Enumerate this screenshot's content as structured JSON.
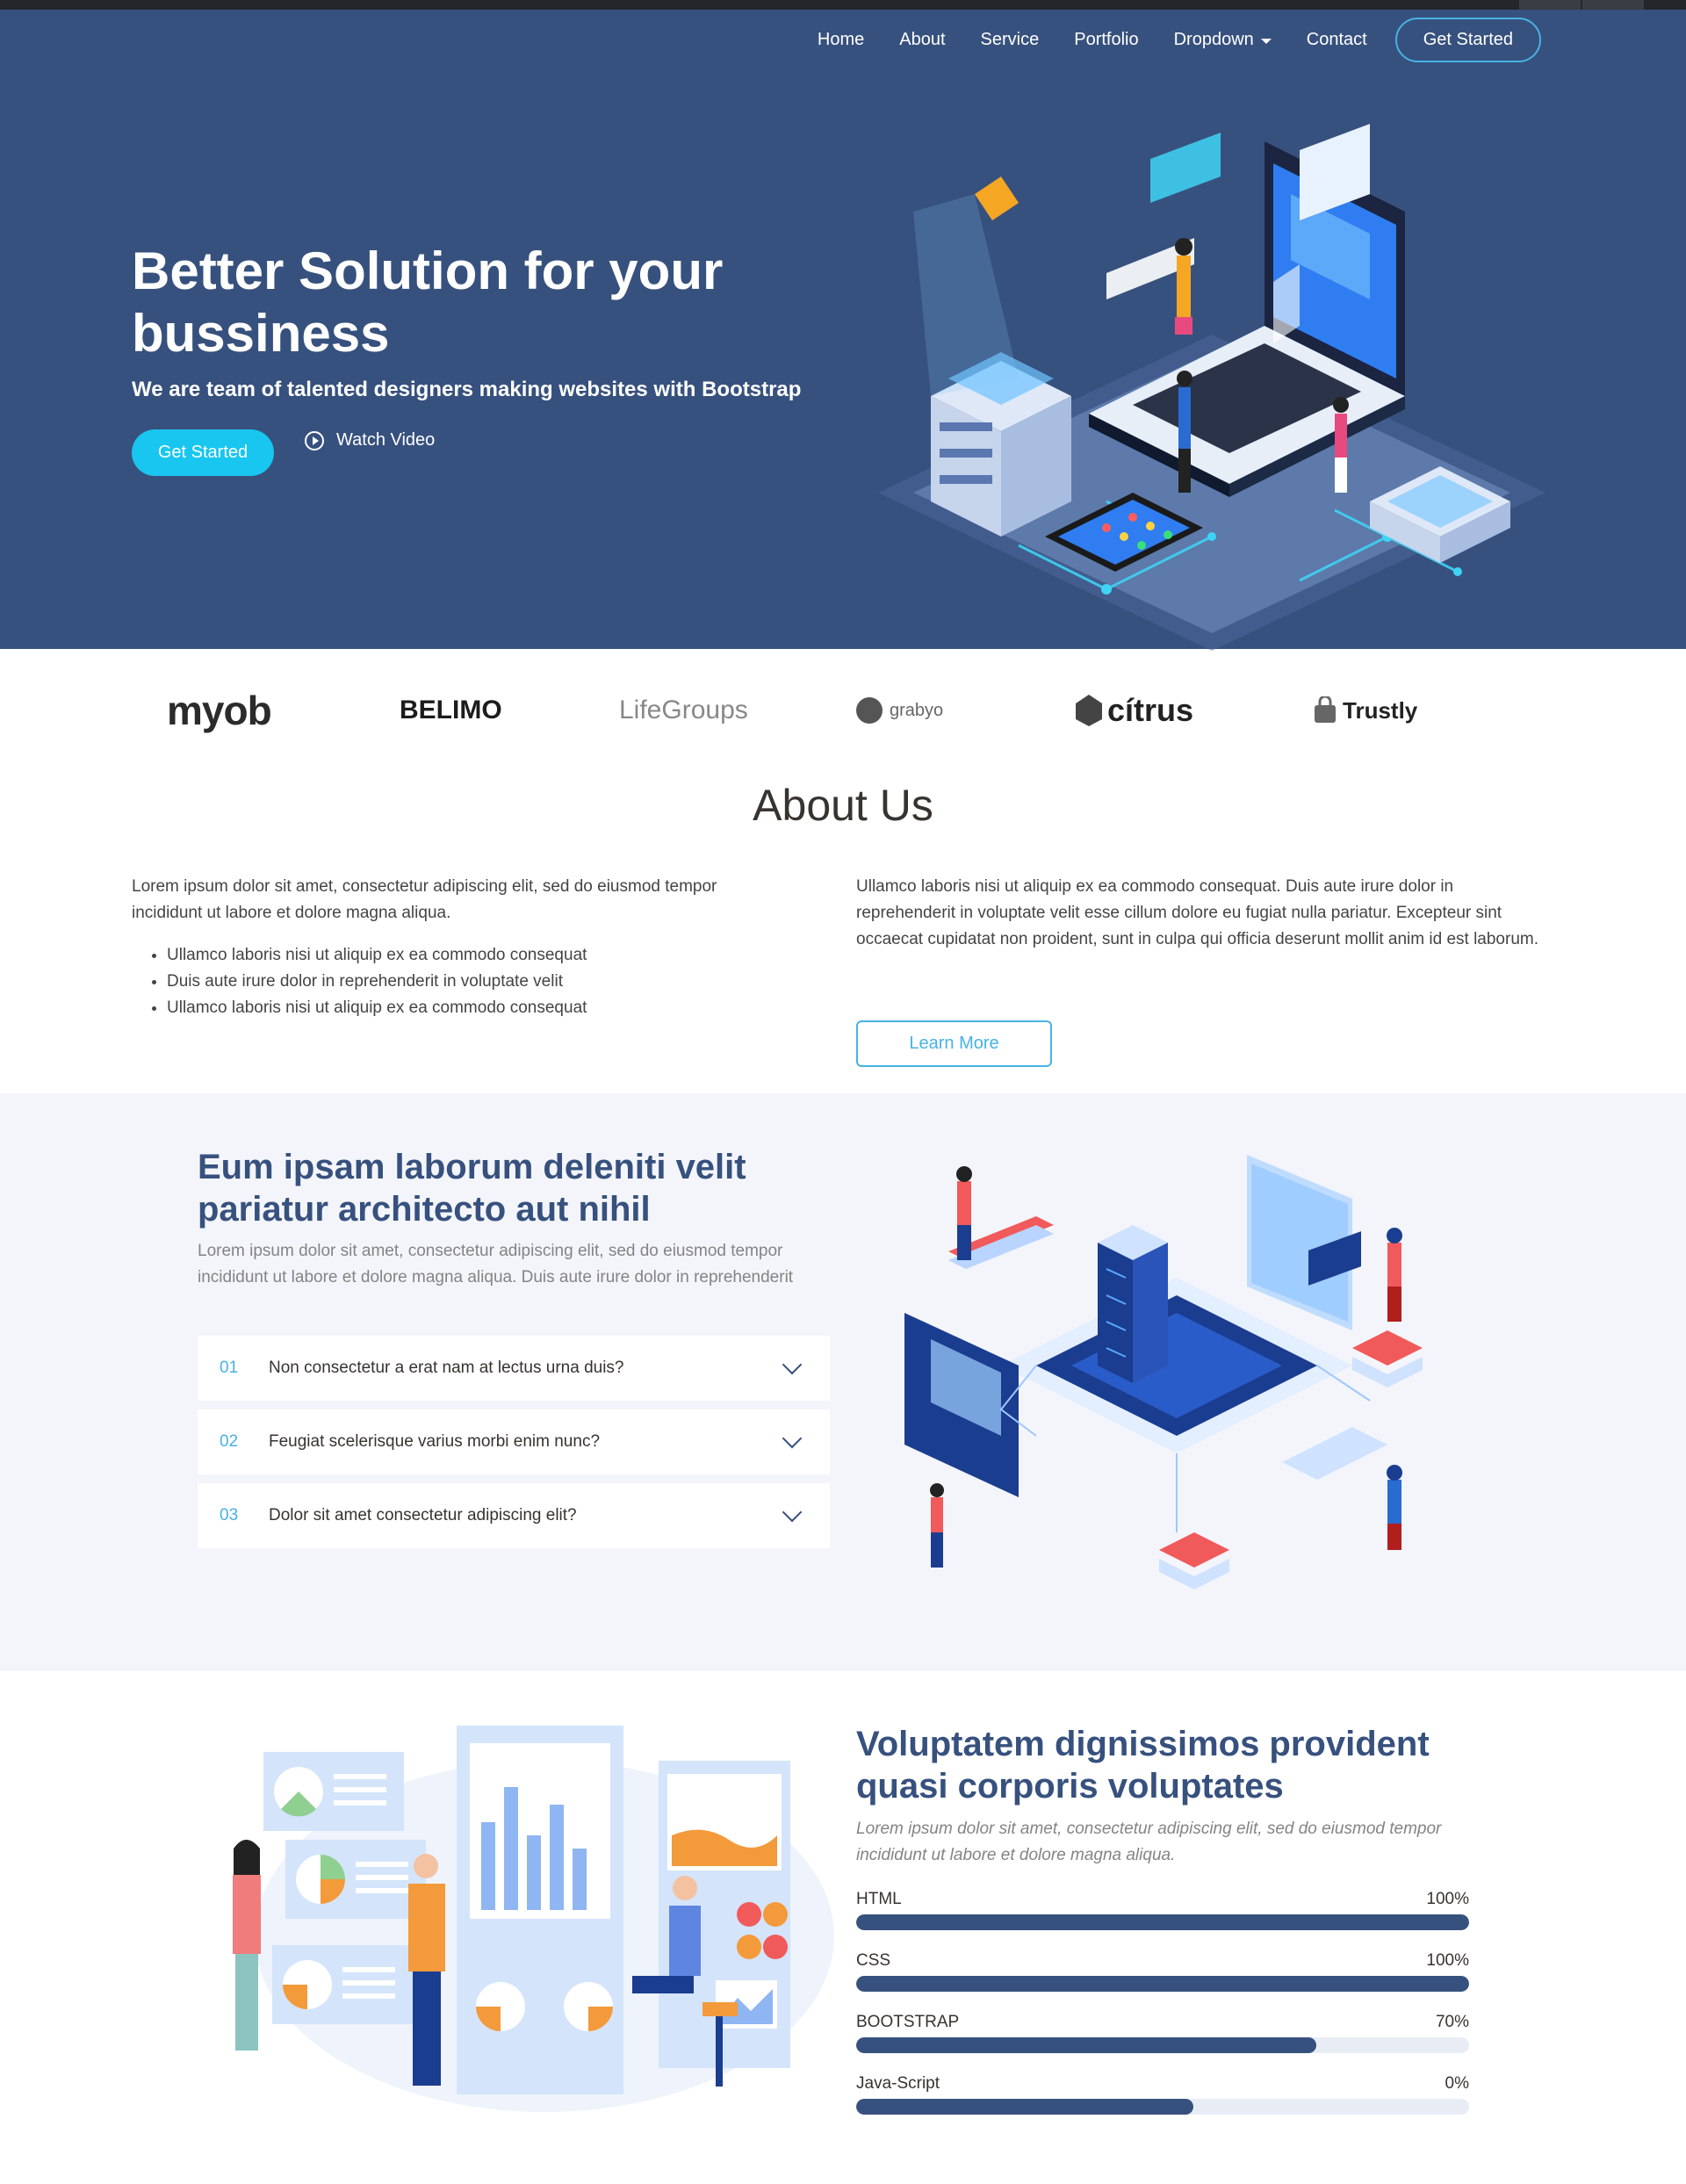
{
  "nav": {
    "items": [
      "Home",
      "About",
      "Service",
      "Portfolio",
      "Dropdown",
      "Contact"
    ],
    "cta": "Get Started"
  },
  "hero": {
    "title": "Better Solution for your bussiness",
    "subtitle": "We are team of talented designers making websites with Bootstrap",
    "button": "Get Started",
    "watch": "Watch Video"
  },
  "clients": [
    "myob",
    "BELIMO",
    "LifeGroups",
    "grabyo",
    "cítrus",
    "Trustly"
  ],
  "about": {
    "title": "About Us",
    "left_text": "Lorem ipsum dolor sit amet, consectetur adipiscing elit, sed do eiusmod tempor incididunt ut labore et dolore magna aliqua.",
    "bullets": [
      "Ullamco laboris nisi ut aliquip ex ea commodo consequat",
      "Duis aute irure dolor in reprehenderit in voluptate velit",
      "Ullamco laboris nisi ut aliquip ex ea commodo consequat"
    ],
    "right_text": "Ullamco laboris nisi ut aliquip ex ea commodo consequat. Duis aute irure dolor in reprehenderit in voluptate velit esse cillum dolore eu fugiat nulla pariatur. Excepteur sint occaecat cupidatat non proident, sunt in culpa qui officia deserunt mollit anim id est laborum.",
    "button": "Learn More"
  },
  "why": {
    "title_normal": "Eum ipsam laborum deleniti ",
    "title_bold_1": "velit",
    "title_bold_2": "pariatur architecto aut nihil",
    "description": "Lorem ipsum dolor sit amet, consectetur adipiscing elit, sed do eiusmod tempor incididunt ut labore et dolore magna aliqua. Duis aute irure dolor in reprehenderit",
    "faqs": [
      {
        "num": "01",
        "question": "Non consectetur a erat nam at lectus urna duis?"
      },
      {
        "num": "02",
        "question": "Feugiat scelerisque varius morbi enim nunc?"
      },
      {
        "num": "03",
        "question": "Dolor sit amet consectetur adipiscing elit?"
      }
    ]
  },
  "skills": {
    "title": "Voluptatem dignissimos provident quasi corporis voluptates",
    "description": "Lorem ipsum dolor sit amet, consectetur adipiscing elit, sed do eiusmod tempor incididunt ut labore et dolore magna aliqua.",
    "items": [
      {
        "name": "HTML",
        "label": "100%",
        "level": 100
      },
      {
        "name": "CSS",
        "label": "100%",
        "level": 100
      },
      {
        "name": "BOOTSTRAP",
        "label": "70%",
        "level": 75
      },
      {
        "name": "Java-Script",
        "label": "0%",
        "level": 55
      }
    ]
  },
  "colors": {
    "hero_bg": "#37517e",
    "accent": "#47b2e4",
    "cta": "#18c6f0",
    "section_bg": "#f3f5fa"
  }
}
